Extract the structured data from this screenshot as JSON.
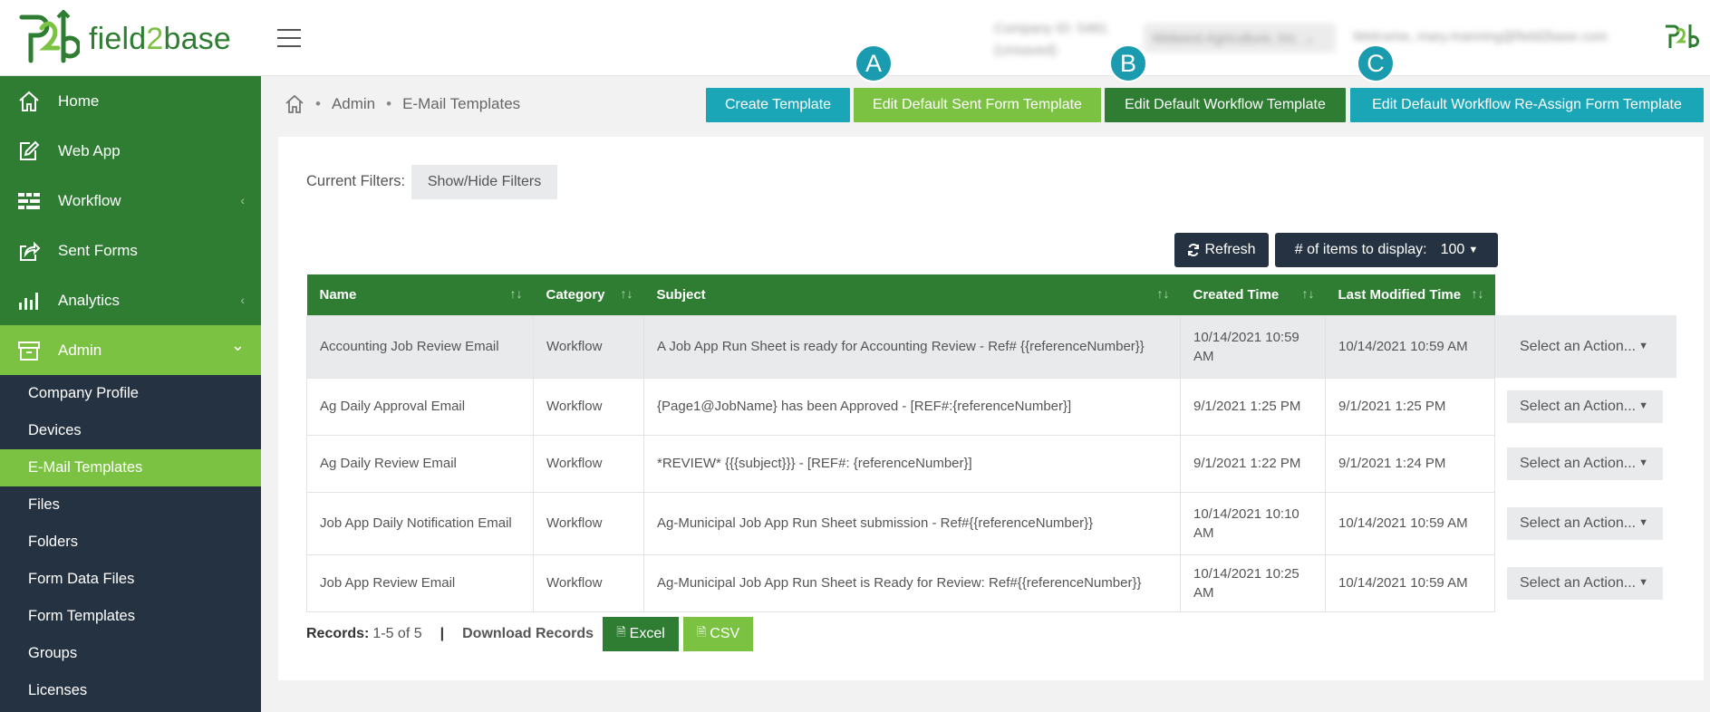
{
  "brand": {
    "name_prefix": "field",
    "name_two": "2",
    "name_suffix": "base"
  },
  "topbar": {
    "company": "Company ID: 5481",
    "company_sub": "(Unsaved)",
    "selected_company": "Midwest Agriculture, Inc.",
    "welcome": "Welcome, mary.manning@field2base.com"
  },
  "sidebar": {
    "main": [
      {
        "label": "Home",
        "icon": "home-icon"
      },
      {
        "label": "Web App",
        "icon": "edit-icon"
      },
      {
        "label": "Workflow",
        "icon": "workflow-icon",
        "chevron": "‹"
      },
      {
        "label": "Sent Forms",
        "icon": "share-icon"
      },
      {
        "label": "Analytics",
        "icon": "bar-chart-icon",
        "chevron": "‹"
      },
      {
        "label": "Admin",
        "icon": "archive-icon",
        "chevron": "⌄"
      }
    ],
    "sub": [
      "Company Profile",
      "Devices",
      "E-Mail Templates",
      "Files",
      "Folders",
      "Form Data Files",
      "Form Templates",
      "Groups",
      "Licenses"
    ]
  },
  "breadcrumb": {
    "sep": "•",
    "admin": "Admin",
    "page": "E-Mail Templates"
  },
  "toolbar": {
    "create": "Create Template",
    "edit_sent": "Edit Default Sent Form Template",
    "edit_workflow": "Edit Default Workflow Template",
    "edit_reassign": "Edit Default Workflow Re-Assign Form Template",
    "badge_a": "A",
    "badge_b": "B",
    "badge_c": "C"
  },
  "filters": {
    "label": "Current Filters:",
    "button": "Show/Hide Filters"
  },
  "controls": {
    "refresh": "Refresh",
    "items_label": "# of items to display:",
    "items_value": "100"
  },
  "table": {
    "columns": [
      "Name",
      "Category",
      "Subject",
      "Created Time",
      "Last Modified Time"
    ],
    "sort_glyph": "↑↓",
    "rows": [
      {
        "name": "Accounting Job Review Email",
        "category": "Workflow",
        "subject": "A Job App Run Sheet is ready for Accounting Review - Ref# {{referenceNumber}}",
        "created": "10/14/2021 10:59 AM",
        "modified": "10/14/2021 10:59 AM",
        "action": "Select an Action..."
      },
      {
        "name": "Ag Daily Approval Email",
        "category": "Workflow",
        "subject": "{Page1@JobName} has been Approved - [REF#:{referenceNumber}]",
        "created": "9/1/2021 1:25 PM",
        "modified": "9/1/2021 1:25 PM",
        "action": "Select an Action..."
      },
      {
        "name": "Ag Daily Review Email",
        "category": "Workflow",
        "subject": "*REVIEW* {{{subject}}} - [REF#: {referenceNumber}]",
        "created": "9/1/2021 1:22 PM",
        "modified": "9/1/2021 1:24 PM",
        "action": "Select an Action..."
      },
      {
        "name": "Job App Daily Notification Email",
        "category": "Workflow",
        "subject": "Ag-Municipal Job App Run Sheet submission - Ref#{{referenceNumber}}",
        "created": "10/14/2021 10:10 AM",
        "modified": "10/14/2021 10:59 AM",
        "action": "Select an Action..."
      },
      {
        "name": "Job App Review Email",
        "category": "Workflow",
        "subject": "Ag-Municipal Job App Run Sheet is Ready for Review: Ref#{{referenceNumber}}",
        "created": "10/14/2021 10:25 AM",
        "modified": "10/14/2021 10:59 AM",
        "action": "Select an Action..."
      }
    ]
  },
  "footer": {
    "records_label": "Records:",
    "records_value": "1-5 of 5",
    "divider": "|",
    "download": "Download Records",
    "excel": "Excel",
    "csv": "CSV"
  },
  "colors": {
    "green_dark": "#2e7d32",
    "green_light": "#7cc242",
    "teal": "#1ba6b8",
    "navy": "#253241"
  }
}
